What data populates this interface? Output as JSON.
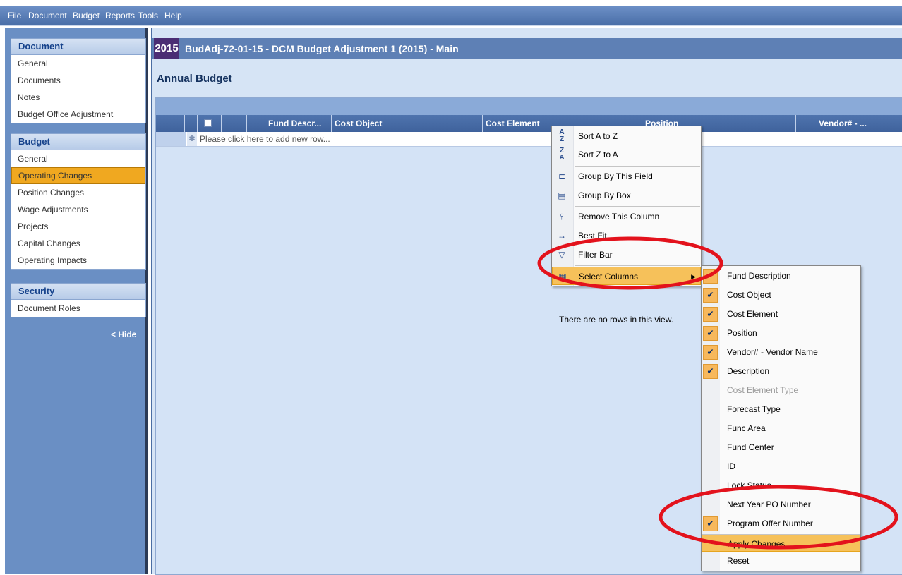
{
  "menu": [
    "File",
    "Document",
    "Budget",
    "Reports",
    "Tools",
    "Help"
  ],
  "sidebar": {
    "document": {
      "title": "Document",
      "items": [
        "General",
        "Documents",
        "Notes",
        "Budget Office Adjustment"
      ]
    },
    "budget": {
      "title": "Budget",
      "items": [
        "General",
        "Operating Changes",
        "Position Changes",
        "Wage Adjustments",
        "Projects",
        "Capital Changes",
        "Operating Impacts"
      ],
      "selected": "Operating Changes"
    },
    "security": {
      "title": "Security",
      "items": [
        "Document Roles"
      ]
    },
    "hide_label": "< Hide"
  },
  "header": {
    "year": "2015",
    "title": "BudAdj-72-01-15 - DCM Budget Adjustment 1 (2015) - Main"
  },
  "page_title": "Annual Budget",
  "grid": {
    "columns": [
      "Fund Descr...",
      "Cost Object",
      "Cost Element",
      "Position",
      "Vendor# - ..."
    ],
    "new_row_text": "Please click here to add new row...",
    "empty_text": "There are no rows in this view."
  },
  "context_menu": {
    "items": [
      {
        "label": "Sort A to Z",
        "icon": "sort-asc-icon"
      },
      {
        "label": "Sort Z to A",
        "icon": "sort-desc-icon"
      },
      {
        "label": "Group By This Field",
        "icon": "group-field-icon"
      },
      {
        "label": "Group By Box",
        "icon": "group-box-icon"
      },
      {
        "label": "Remove This Column",
        "icon": "remove-column-icon"
      },
      {
        "label": "Best Fit",
        "icon": "best-fit-icon"
      },
      {
        "label": "Filter Bar",
        "icon": "filter-icon"
      },
      {
        "label": "Select Columns",
        "icon": "columns-icon"
      }
    ]
  },
  "columns_submenu": {
    "items": [
      {
        "label": "Fund Description",
        "checked": false,
        "disabled": false
      },
      {
        "label": "Cost Object",
        "checked": true,
        "disabled": false
      },
      {
        "label": "Cost Element",
        "checked": true,
        "disabled": false
      },
      {
        "label": "Position",
        "checked": true,
        "disabled": false
      },
      {
        "label": "Vendor# - Vendor Name",
        "checked": true,
        "disabled": false
      },
      {
        "label": "Description",
        "checked": true,
        "disabled": false
      },
      {
        "label": "Cost Element Type",
        "checked": false,
        "disabled": true
      },
      {
        "label": "Forecast Type",
        "checked": false,
        "disabled": false
      },
      {
        "label": "Func Area",
        "checked": false,
        "disabled": false
      },
      {
        "label": "Fund Center",
        "checked": false,
        "disabled": false
      },
      {
        "label": "ID",
        "checked": false,
        "disabled": false
      },
      {
        "label": "Lock Status",
        "checked": false,
        "disabled": false
      },
      {
        "label": "Next Year PO Number",
        "checked": false,
        "disabled": false
      },
      {
        "label": "Program Offer Number",
        "checked": true,
        "disabled": false
      }
    ],
    "apply_label": "Apply Changes",
    "reset_label": "Reset"
  },
  "colors": {
    "accent": "#f0a820",
    "header_blue": "#5e80b5",
    "year_purple": "#4b2d74",
    "annotation_red": "#e3121c"
  }
}
